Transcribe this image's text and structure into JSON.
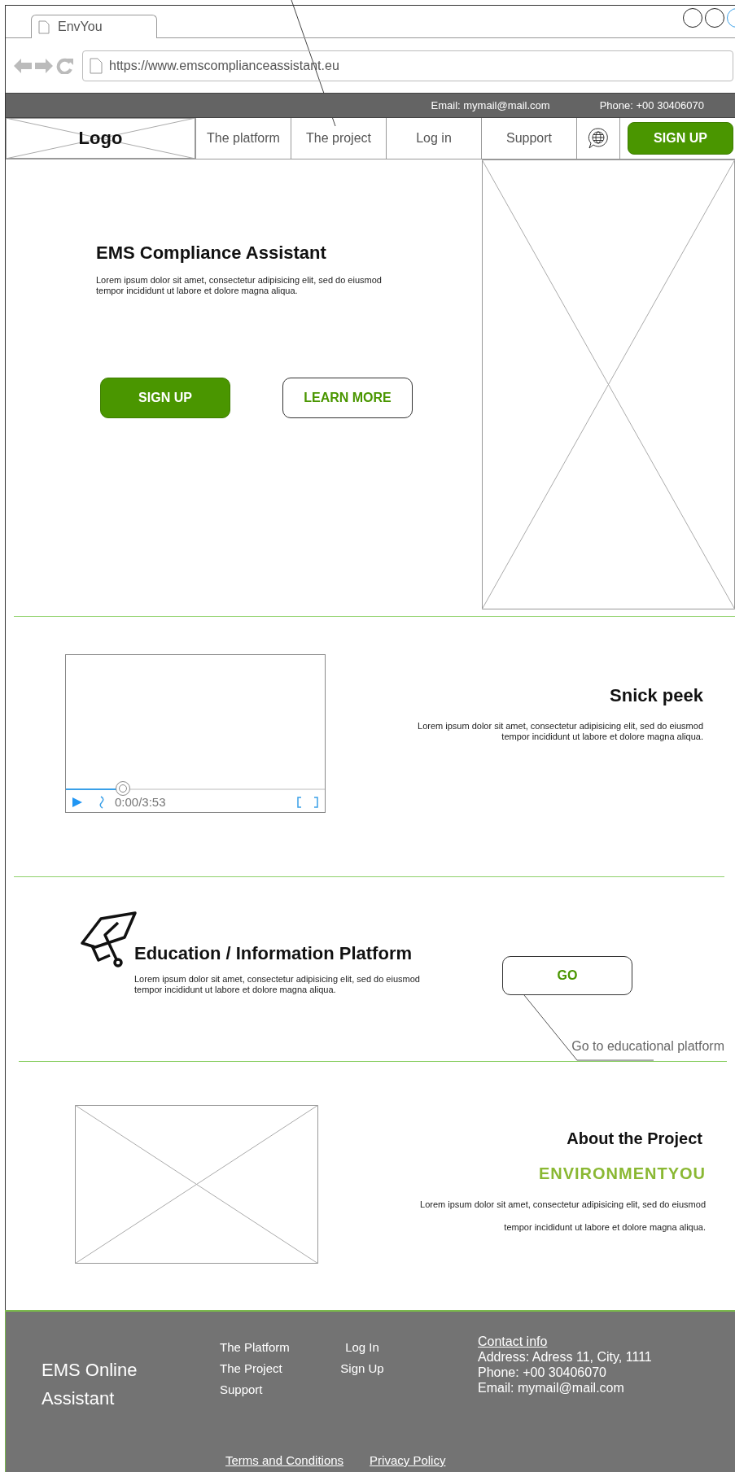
{
  "browser": {
    "tab_title": "EnvYou",
    "url": "https://www.emscomplianceassistant.eu"
  },
  "top_bar": {
    "email": "Email: mymail@mail.com",
    "phone": "Phone: +00 30406070"
  },
  "nav": {
    "logo": "Logo",
    "items": [
      {
        "label": "The platform"
      },
      {
        "label": "The project"
      },
      {
        "label": "Log in"
      },
      {
        "label": "Support"
      }
    ],
    "signup": "SIGN UP"
  },
  "hero": {
    "title": "EMS Compliance Assistant",
    "text": "Lorem ipsum dolor sit amet, consectetur adipisicing elit, sed do eiusmod tempor incididunt ut labore et dolore magna aliqua.",
    "buttons": [
      {
        "label": "SIGN UP",
        "kind": "primary"
      },
      {
        "label": "LEARN MORE",
        "kind": "outline"
      }
    ]
  },
  "video_section": {
    "player": {
      "time": "0:00/3:53",
      "level": 0.22
    },
    "title": "Snick peek",
    "text": "Lorem ipsum dolor sit amet, consectetur adipisicing elit, sed do eiusmod tempor incididunt ut labore et dolore magna aliqua."
  },
  "education": {
    "title": "Education / Information Platform",
    "text": "Lorem ipsum dolor sit amet, consectetur adipisicing elit, sed do eiusmod tempor incididunt ut labore et dolore magna aliqua.",
    "button": "GO",
    "note": "Go to educational platform"
  },
  "about": {
    "title": "About the Project",
    "subtitle": "ENVIRONMENTYOU",
    "text": "Lorem ipsum dolor sit amet, consectetur adipisicing elit, sed do eiusmod tempor incididunt ut labore et dolore magna aliqua."
  },
  "footer": {
    "brand": "EMS Online Assistant",
    "links_1": [
      "The Platform",
      "The Project",
      "Support"
    ],
    "links_2": [
      "Log In",
      "Sign Up"
    ],
    "contact": {
      "heading": "Contact info",
      "lines": [
        "Address: Adress 11, City, 1111",
        "Phone: +00 30406070",
        "Email: mymail@mail.com"
      ]
    },
    "legal": [
      "Terms and Conditions",
      "Privacy Policy"
    ]
  }
}
